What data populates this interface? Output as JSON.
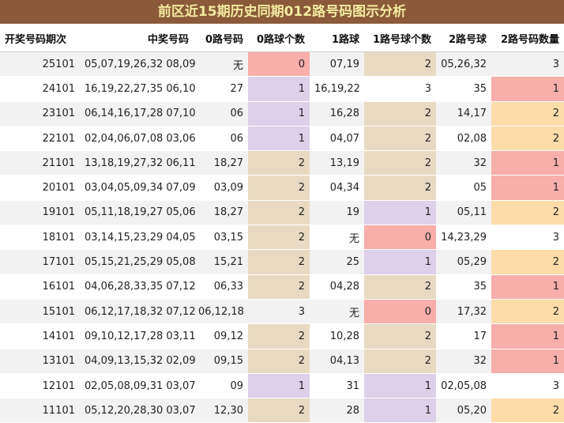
{
  "title": "前区近15期历史同期012路号码图示分析",
  "headers": [
    "开奖号码期次",
    "中奖号码",
    "0路号码",
    "0路球个数",
    "1路球",
    "1路号球个数",
    "2路号球",
    "2路号码数量"
  ],
  "colors": {
    "title_bg": "#8b5a3a",
    "title_text": "#f2eaa0",
    "count_0": "#f8aeaa",
    "count_1": "#ddd0e8",
    "count_2": "#e8dac2",
    "count_3": "#f2f2f2",
    "route2_count_1": "#f8aeaa",
    "route2_count_2": "#fddcaa"
  },
  "rows": [
    {
      "period": "25101",
      "numbers": "05,07,19,26,32 08,09",
      "r0": "无",
      "c0": "0",
      "r1": "07,19",
      "c1": "2",
      "r2": "05,26,32",
      "c2": "3"
    },
    {
      "period": "24101",
      "numbers": "16,19,22,27,35 06,10",
      "r0": "27",
      "c0": "1",
      "r1": "16,19,22",
      "c1": "3",
      "r2": "35",
      "c2": "1"
    },
    {
      "period": "23101",
      "numbers": "06,14,16,17,28 07,10",
      "r0": "06",
      "c0": "1",
      "r1": "16,28",
      "c1": "2",
      "r2": "14,17",
      "c2": "2"
    },
    {
      "period": "22101",
      "numbers": "02,04,06,07,08 03,06",
      "r0": "06",
      "c0": "1",
      "r1": "04,07",
      "c1": "2",
      "r2": "02,08",
      "c2": "2"
    },
    {
      "period": "21101",
      "numbers": "13,18,19,27,32 06,11",
      "r0": "18,27",
      "c0": "2",
      "r1": "13,19",
      "c1": "2",
      "r2": "32",
      "c2": "1"
    },
    {
      "period": "20101",
      "numbers": "03,04,05,09,34 07,09",
      "r0": "03,09",
      "c0": "2",
      "r1": "04,34",
      "c1": "2",
      "r2": "05",
      "c2": "1"
    },
    {
      "period": "19101",
      "numbers": "05,11,18,19,27 05,06",
      "r0": "18,27",
      "c0": "2",
      "r1": "19",
      "c1": "1",
      "r2": "05,11",
      "c2": "2"
    },
    {
      "period": "18101",
      "numbers": "03,14,15,23,29 04,05",
      "r0": "03,15",
      "c0": "2",
      "r1": "无",
      "c1": "0",
      "r2": "14,23,29",
      "c2": "3"
    },
    {
      "period": "17101",
      "numbers": "05,15,21,25,29 05,08",
      "r0": "15,21",
      "c0": "2",
      "r1": "25",
      "c1": "1",
      "r2": "05,29",
      "c2": "2"
    },
    {
      "period": "16101",
      "numbers": "04,06,28,33,35 07,12",
      "r0": "06,33",
      "c0": "2",
      "r1": "04,28",
      "c1": "2",
      "r2": "35",
      "c2": "1"
    },
    {
      "period": "15101",
      "numbers": "06,12,17,18,32 07,12",
      "r0": "06,12,18",
      "c0": "3",
      "r1": "无",
      "c1": "0",
      "r2": "17,32",
      "c2": "2"
    },
    {
      "period": "14101",
      "numbers": "09,10,12,17,28 03,11",
      "r0": "09,12",
      "c0": "2",
      "r1": "10,28",
      "c1": "2",
      "r2": "17",
      "c2": "1"
    },
    {
      "period": "13101",
      "numbers": "04,09,13,15,32 02,09",
      "r0": "09,15",
      "c0": "2",
      "r1": "04,13",
      "c1": "2",
      "r2": "32",
      "c2": "1"
    },
    {
      "period": "12101",
      "numbers": "02,05,08,09,31 03,07",
      "r0": "09",
      "c0": "1",
      "r1": "31",
      "c1": "1",
      "r2": "02,05,08",
      "c2": "3"
    },
    {
      "period": "11101",
      "numbers": "05,12,20,28,30 03,07",
      "r0": "12,30",
      "c0": "2",
      "r1": "28",
      "c1": "1",
      "r2": "05,20",
      "c2": "2"
    }
  ]
}
